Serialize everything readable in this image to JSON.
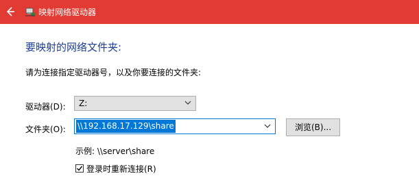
{
  "window": {
    "title": "映射网络驱动器",
    "back_icon": "back-arrow-icon",
    "app_icon": "network-drive-icon",
    "titlebar_color": "#e23b33"
  },
  "heading": "要映射的网络文件夹:",
  "description": "请为连接指定驱动器号，以及你要连接的文件夹:",
  "drive": {
    "label": "驱动器(D):",
    "value": "Z:"
  },
  "folder": {
    "label": "文件夹(O):",
    "value": "\\\\192.168.17.129\\share",
    "browse_label": "浏览(B)..."
  },
  "example": "示例: \\\\server\\share",
  "reconnect": {
    "label": "登录时重新连接(R)",
    "checked": true
  },
  "colors": {
    "accent": "#0078d7",
    "heading": "#1e3f91"
  }
}
